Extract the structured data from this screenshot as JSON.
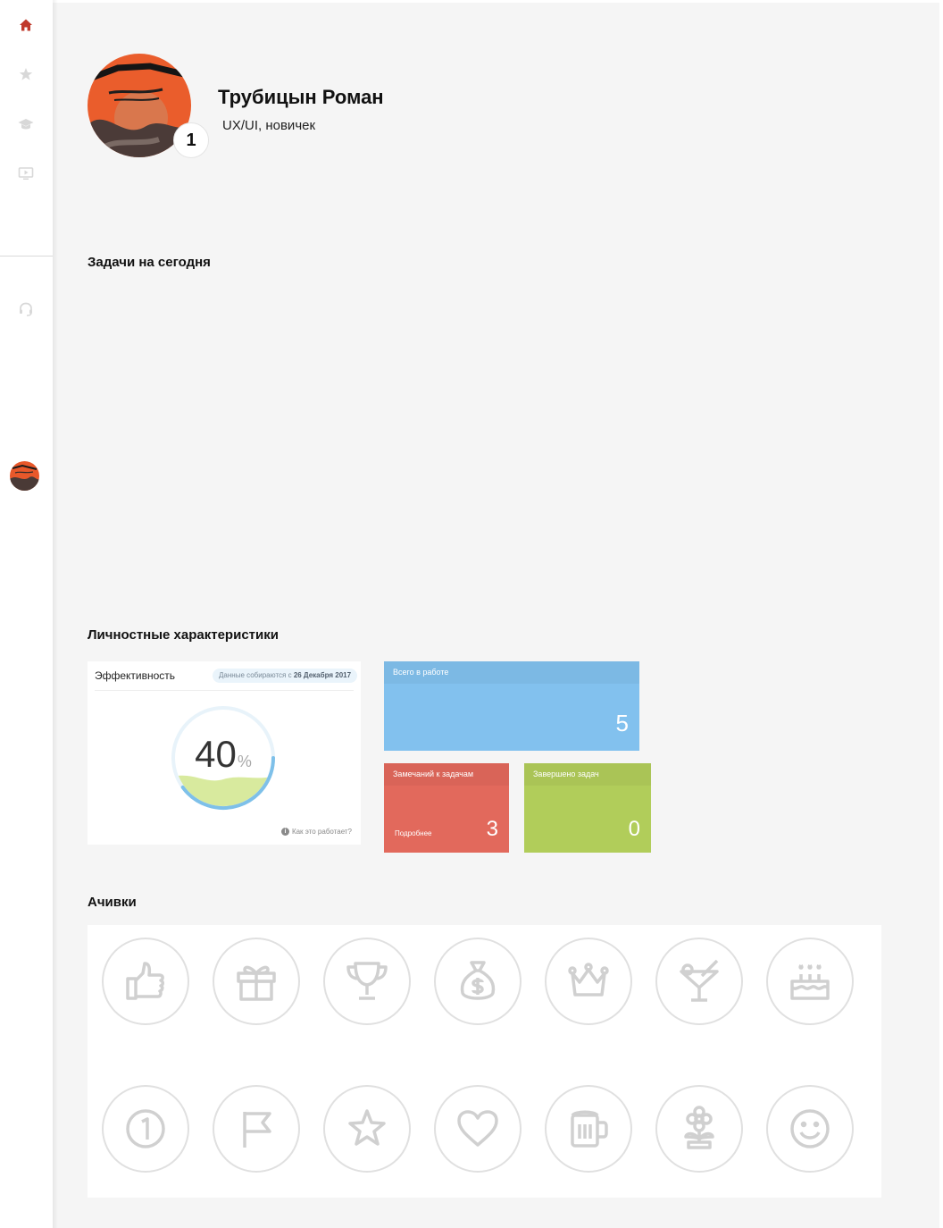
{
  "profile": {
    "name": "Трубицын Роман",
    "role": "UX/UI, новичек",
    "level": "1"
  },
  "sections": {
    "tasks_today": "Задачи на сегодня",
    "personal": "Личностные характеристики",
    "achievements": "Ачивки"
  },
  "efficiency": {
    "title": "Эффективность",
    "chip_prefix": "Данные собираются с",
    "chip_date": "26 Декабря 2017",
    "value": "40",
    "unit": "%",
    "level": 0.4,
    "how_link": "Как это работает?"
  },
  "stats": {
    "in_work": {
      "label": "Всего в работе",
      "value": "5",
      "color": "#82c1ee"
    },
    "remarks": {
      "label": "Замечаний к задачам",
      "value": "3",
      "more": "Подробнее",
      "color": "#e2695c"
    },
    "done": {
      "label": "Завершено задач",
      "value": "0",
      "color": "#b1cd5a"
    }
  },
  "nav": {
    "active_color": "#c0392b",
    "items": [
      "home-icon",
      "star-icon",
      "graduation-cap-icon",
      "video-icon",
      "headset-icon"
    ]
  },
  "achievements": [
    "thumbs-up-icon",
    "gift-icon",
    "trophy-icon",
    "money-bag-icon",
    "crown-icon",
    "cocktail-icon",
    "birthday-cake-icon",
    "number-one-icon",
    "flag-icon",
    "star-icon",
    "heart-icon",
    "beer-mug-icon",
    "flower-icon",
    "smiley-icon"
  ]
}
